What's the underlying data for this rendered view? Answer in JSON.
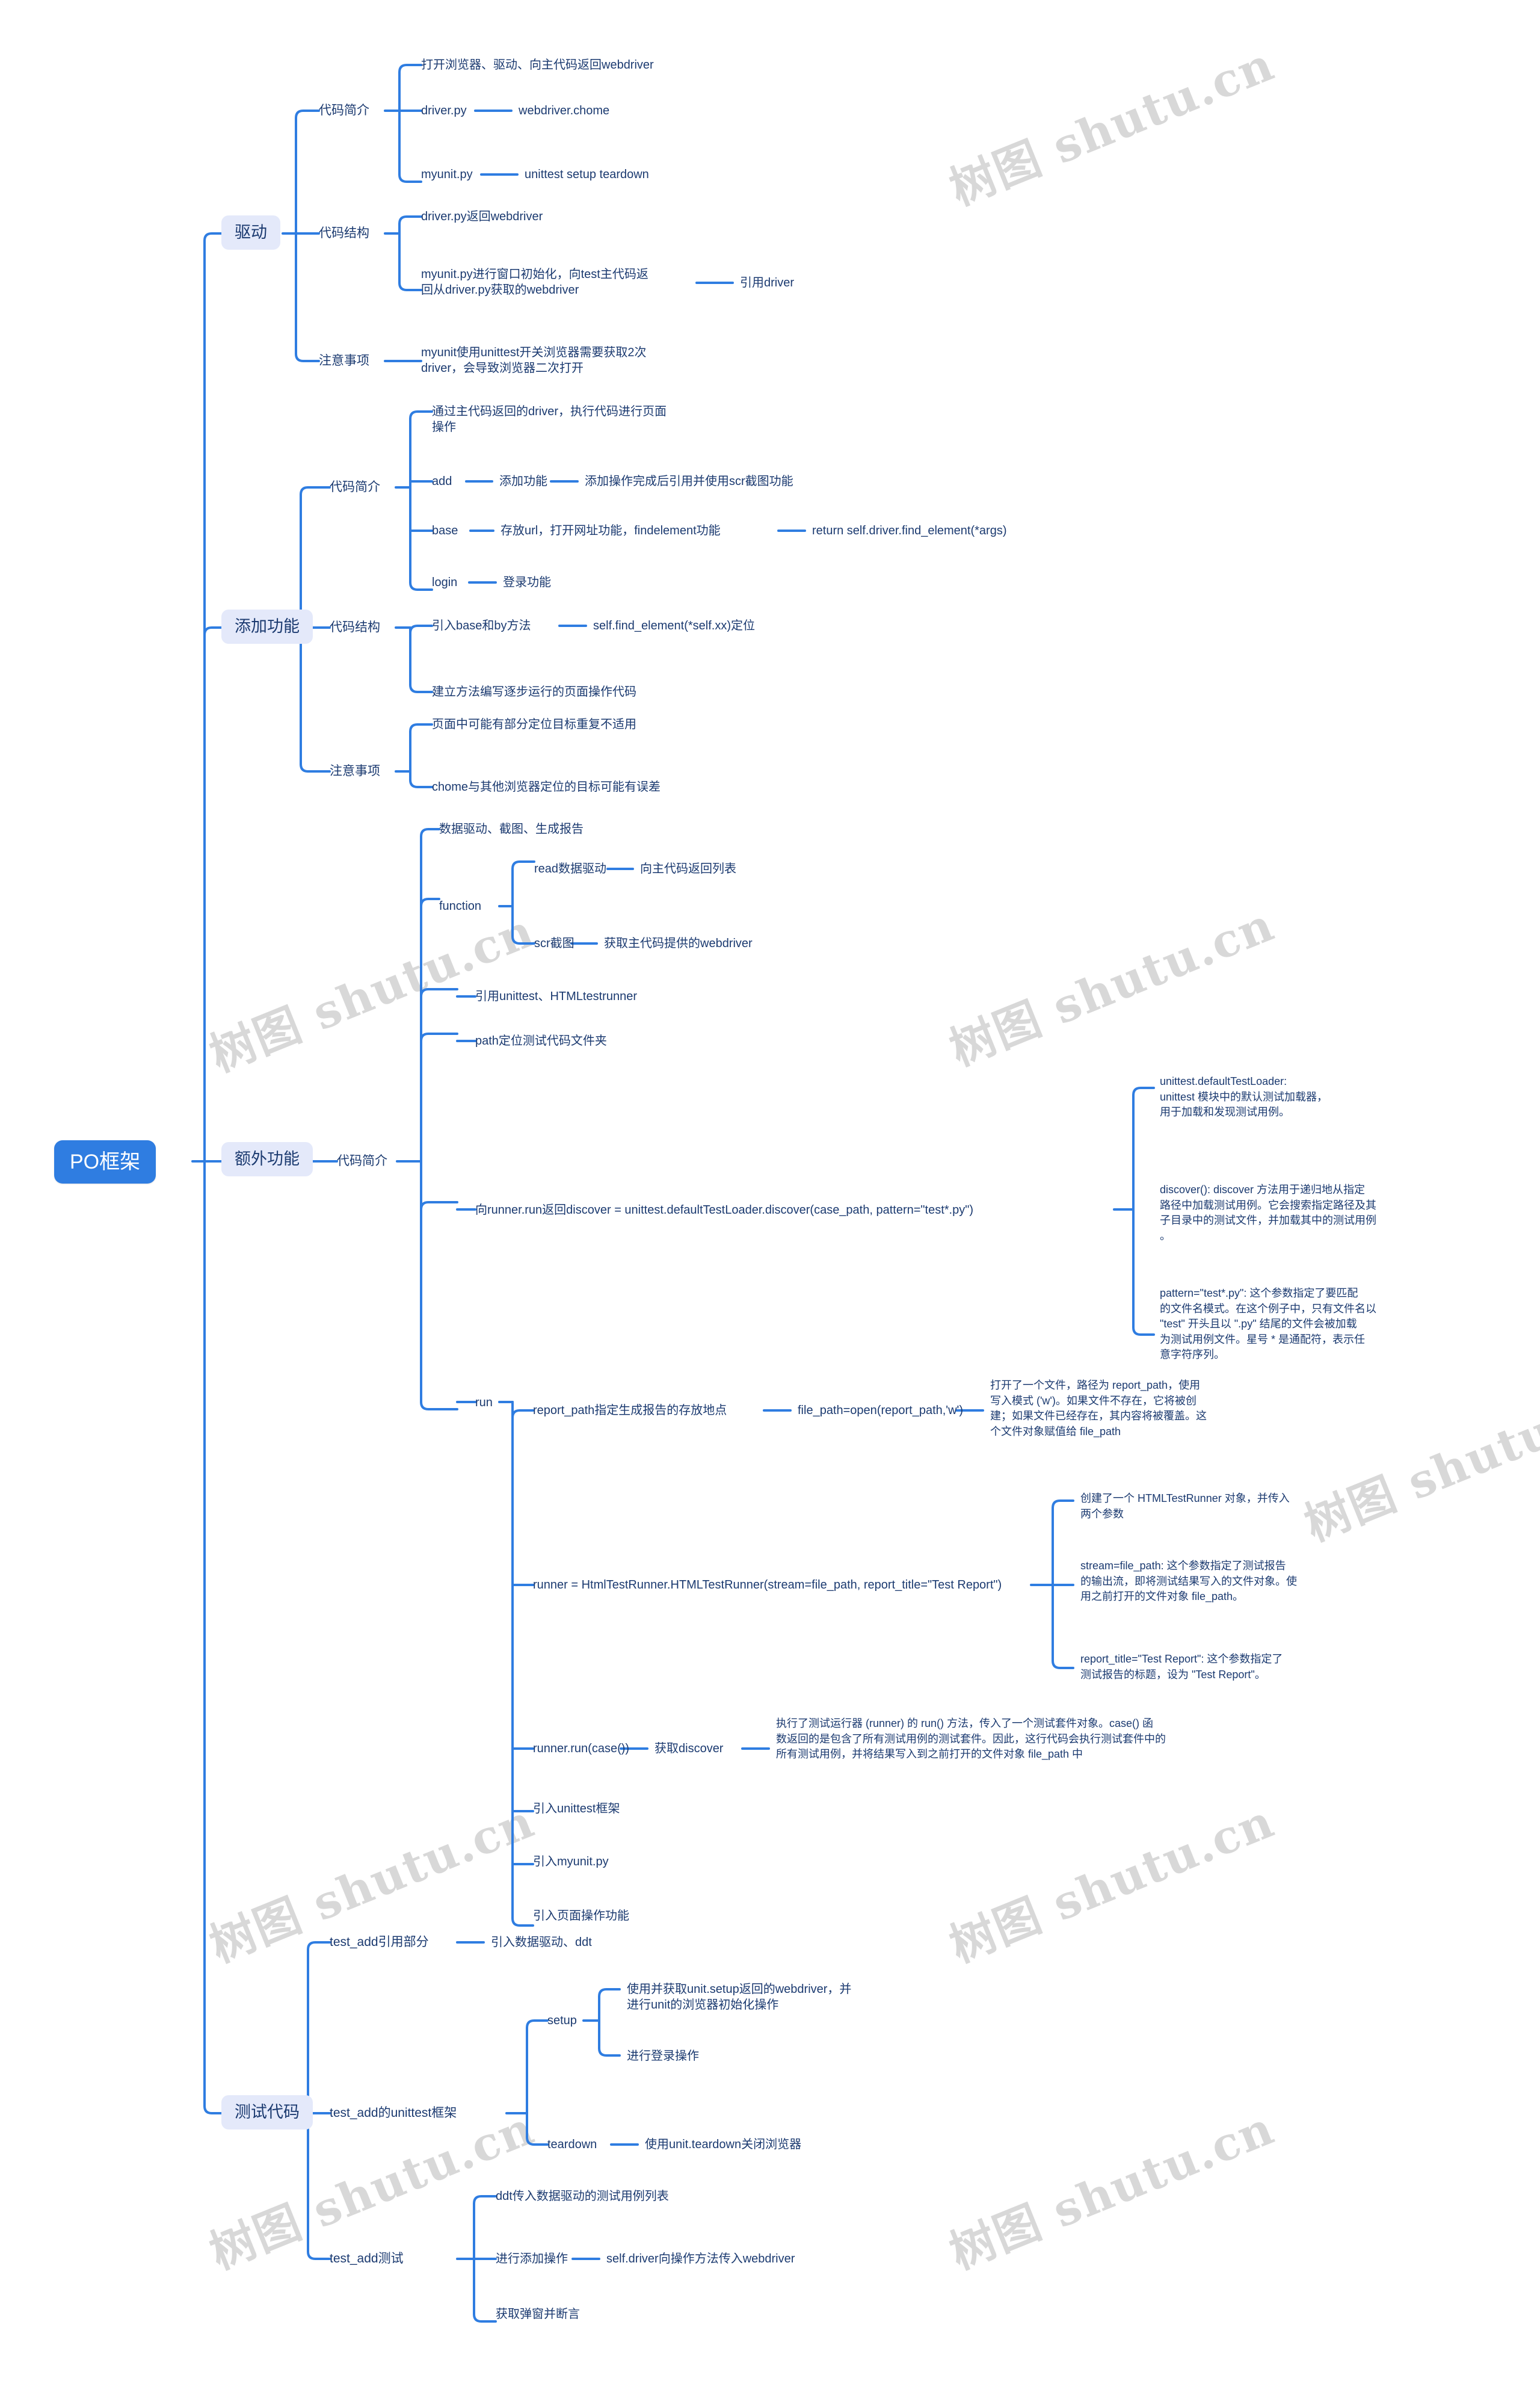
{
  "meta": {
    "watermark_text": "树图 shutu.cn",
    "accent_color": "#2f7de1",
    "root_bg": "#2f7de1",
    "branch_bg": "#e4e9fa",
    "text_color": "#1b3a70"
  },
  "root": {
    "label": "PO框架"
  },
  "branches": [
    {
      "label": "驱动",
      "groups": [
        {
          "label": "代码简介",
          "items": [
            {
              "label": "打开浏览器、驱动、向主代码返回webdriver",
              "children": []
            },
            {
              "label": "driver.py",
              "children": [
                {
                  "label": "webdriver.chome"
                }
              ]
            },
            {
              "label": "myunit.py",
              "children": [
                {
                  "label": "unittest  setup teardown"
                }
              ]
            }
          ]
        },
        {
          "label": "代码结构",
          "items": [
            {
              "label": "driver.py返回webdriver",
              "children": []
            },
            {
              "label": "myunit.py进行窗口初始化，向test主代码返\n回从driver.py获取的webdriver",
              "children": [
                {
                  "label": "引用driver"
                }
              ]
            }
          ]
        },
        {
          "label": "注意事项",
          "items": [
            {
              "label": "myunit使用unittest开关浏览器需要获取2次\ndriver，会导致浏览器二次打开",
              "children": []
            }
          ]
        }
      ]
    },
    {
      "label": "添加功能",
      "groups": [
        {
          "label": "代码简介",
          "items": [
            {
              "label": "通过主代码返回的driver，执行代码进行页面\n操作",
              "children": []
            },
            {
              "label": "add",
              "children": [
                {
                  "label": "添加功能"
                },
                {
                  "label": "添加操作完成后引用并使用scr截图功能"
                }
              ]
            },
            {
              "label": "base",
              "children": [
                {
                  "label": "存放url，打开网址功能，findelement功能"
                },
                {
                  "label": "return self.driver.find_element(*args)"
                }
              ]
            },
            {
              "label": "login",
              "children": [
                {
                  "label": "登录功能"
                }
              ]
            }
          ]
        },
        {
          "label": "代码结构",
          "items": [
            {
              "label": "引入base和by方法",
              "children": [
                {
                  "label": "self.find_element(*self.xx)定位"
                }
              ]
            },
            {
              "label": "建立方法编写逐步运行的页面操作代码",
              "children": []
            }
          ]
        },
        {
          "label": "注意事项",
          "items": [
            {
              "label": "页面中可能有部分定位目标重复不适用",
              "children": []
            },
            {
              "label": "chome与其他浏览器定位的目标可能有误差",
              "children": []
            }
          ]
        }
      ]
    },
    {
      "label": "额外功能",
      "groups": [
        {
          "label": "代码简介",
          "items": [
            {
              "label": "数据驱动、截图、生成报告",
              "children": []
            },
            {
              "label": "function",
              "children": [
                {
                  "label": "read数据驱动",
                  "grand": [
                    {
                      "label": "向主代码返回列表"
                    }
                  ]
                },
                {
                  "label": "scr截图",
                  "grand": [
                    {
                      "label": "获取主代码提供的webdriver"
                    }
                  ]
                }
              ]
            },
            {
              "label": "引用unittest、HTMLtestrunner",
              "children": []
            },
            {
              "label": "path定位测试代码文件夹",
              "children": []
            },
            {
              "label": "向runner.run返回discover = unittest.defaultTestLoader.discover(case_path, pattern=\"test*.py\")",
              "children": [
                {
                  "label": "unittest.defaultTestLoader:\nunittest 模块中的默认测试加载器，\n用于加载和发现测试用例。"
                },
                {
                  "label": "discover(): discover 方法用于递归地从指定\n路径中加载测试用例。它会搜索指定路径及其\n子目录中的测试文件，并加载其中的测试用例\n。"
                },
                {
                  "label": "pattern=\"test*.py\": 这个参数指定了要匹配\n的文件名模式。在这个例子中，只有文件名以\n \"test\" 开头且以 \".py\" 结尾的文件会被加载\n为测试用例文件。星号 * 是通配符，表示任\n意字符序列。"
                }
              ]
            },
            {
              "label": "run",
              "children": [
                {
                  "label": "report_path指定生成报告的存放地点",
                  "grand": [
                    {
                      "label": "file_path=open(report_path,'w')",
                      "great": [
                        {
                          "label": "打开了一个文件，路径为 report_path，使用\n写入模式 ('w')。如果文件不存在，它将被创\n建；如果文件已经存在，其内容将被覆盖。这\n个文件对象赋值给 file_path"
                        }
                      ]
                    }
                  ]
                },
                {
                  "label": "runner = HtmlTestRunner.HTMLTestRunner(stream=file_path, report_title=\"Test Report\")",
                  "grand": [
                    {
                      "label": "创建了一个 HTMLTestRunner 对象，并传入\n两个参数"
                    },
                    {
                      "label": "stream=file_path: 这个参数指定了测试报告\n的输出流，即将测试结果写入的文件对象。使\n用之前打开的文件对象 file_path。"
                    },
                    {
                      "label": "report_title=\"Test Report\": 这个参数指定了\n测试报告的标题，设为 \"Test Report\"。"
                    }
                  ]
                },
                {
                  "label": "runner.run(case())",
                  "grand": [
                    {
                      "label": "获取discover",
                      "great": [
                        {
                          "label": "执行了测试运行器 (runner) 的 run() 方法，传入了一个测试套件对象。case() 函\n数返回的是包含了所有测试用例的测试套件。因此，这行代码会执行测试套件中的\n所有测试用例，并将结果写入到之前打开的文件对象 file_path 中"
                        }
                      ]
                    }
                  ]
                },
                {
                  "label": "引入unittest框架",
                  "grand": []
                },
                {
                  "label": "引入myunit.py",
                  "grand": []
                },
                {
                  "label": "引入页面操作功能",
                  "grand": []
                }
              ]
            }
          ]
        }
      ]
    },
    {
      "label": "测试代码",
      "groups": [
        {
          "label": "test_add引用部分",
          "items": [
            {
              "label": "引入数据驱动、ddt",
              "children": []
            }
          ]
        },
        {
          "label": "test_add的unittest框架",
          "items": [
            {
              "label": "setup",
              "children": [
                {
                  "label": "使用并获取unit.setup返回的webdriver，并\n进行unit的浏览器初始化操作"
                },
                {
                  "label": "进行登录操作"
                }
              ]
            },
            {
              "label": "teardown",
              "children": [
                {
                  "label": "使用unit.teardown关闭浏览器"
                }
              ]
            }
          ]
        },
        {
          "label": "test_add测试",
          "items": [
            {
              "label": "ddt传入数据驱动的测试用例列表",
              "children": []
            },
            {
              "label": "进行添加操作",
              "children": [
                {
                  "label": "self.driver向操作方法传入webdriver"
                }
              ]
            },
            {
              "label": "获取弹窗并断言",
              "children": []
            }
          ]
        }
      ]
    }
  ],
  "nodes": {
    "root": "PO框架",
    "b1": "驱动",
    "b1g1": "代码简介",
    "b1g2": "代码结构",
    "b1g3": "注意事项",
    "b1g1i1": "打开浏览器、驱动、向主代码返回webdriver",
    "b1g1i2": "driver.py",
    "b1g1i2c1": "webdriver.chome",
    "b1g1i3": "myunit.py",
    "b1g1i3c1": "unittest  setup teardown",
    "b1g2i1": "driver.py返回webdriver",
    "b1g2i2": "myunit.py进行窗口初始化，向test主代码返\n回从driver.py获取的webdriver",
    "b1g2i2c1": "引用driver",
    "b1g3i1": "myunit使用unittest开关浏览器需要获取2次\ndriver，会导致浏览器二次打开",
    "b2": "添加功能",
    "b2g1": "代码简介",
    "b2g2": "代码结构",
    "b2g3": "注意事项",
    "b2g1i1": "通过主代码返回的driver，执行代码进行页面\n操作",
    "b2g1i2": "add",
    "b2g1i2c1": "添加功能",
    "b2g1i2c2": "添加操作完成后引用并使用scr截图功能",
    "b2g1i3": "base",
    "b2g1i3c1": "存放url，打开网址功能，findelement功能",
    "b2g1i3c2": "return self.driver.find_element(*args)",
    "b2g1i4": "login",
    "b2g1i4c1": "登录功能",
    "b2g2i1": "引入base和by方法",
    "b2g2i1c1": "self.find_element(*self.xx)定位",
    "b2g2i2": "建立方法编写逐步运行的页面操作代码",
    "b2g3i1": "页面中可能有部分定位目标重复不适用",
    "b2g3i2": "chome与其他浏览器定位的目标可能有误差",
    "b3": "额外功能",
    "b3g1": "代码简介",
    "b3i1": "数据驱动、截图、生成报告",
    "b3i2": "function",
    "b3i2c1": "read数据驱动",
    "b3i2c1g1": "向主代码返回列表",
    "b3i2c2": "scr截图",
    "b3i2c2g1": "获取主代码提供的webdriver",
    "b3i3": "引用unittest、HTMLtestrunner",
    "b3i4": "path定位测试代码文件夹",
    "b3i5": "向runner.run返回discover = unittest.defaultTestLoader.discover(case_path, pattern=\"test*.py\")",
    "b3i5c1": "unittest.defaultTestLoader:\nunittest 模块中的默认测试加载器，\n用于加载和发现测试用例。",
    "b3i5c2": "discover(): discover 方法用于递归地从指定\n路径中加载测试用例。它会搜索指定路径及其\n子目录中的测试文件，并加载其中的测试用例\n。",
    "b3i5c3": "pattern=\"test*.py\": 这个参数指定了要匹配\n的文件名模式。在这个例子中，只有文件名以\n \"test\" 开头且以 \".py\" 结尾的文件会被加载\n为测试用例文件。星号 * 是通配符，表示任\n意字符序列。",
    "b3i6": "run",
    "b3i6c1": "report_path指定生成报告的存放地点",
    "b3i6c1g1": "file_path=open(report_path,'w')",
    "b3i6c1g1x1": "打开了一个文件，路径为 report_path，使用\n写入模式 ('w')。如果文件不存在，它将被创\n建；如果文件已经存在，其内容将被覆盖。这\n个文件对象赋值给 file_path",
    "b3i6c2": "runner = HtmlTestRunner.HTMLTestRunner(stream=file_path, report_title=\"Test Report\")",
    "b3i6c2g1": "创建了一个 HTMLTestRunner 对象，并传入\n两个参数",
    "b3i6c2g2": "stream=file_path: 这个参数指定了测试报告\n的输出流，即将测试结果写入的文件对象。使\n用之前打开的文件对象 file_path。",
    "b3i6c2g3": "report_title=\"Test Report\": 这个参数指定了\n测试报告的标题，设为 \"Test Report\"。",
    "b3i6c3": "runner.run(case())",
    "b3i6c3g1": "获取discover",
    "b3i6c3g1x1": "执行了测试运行器 (runner) 的 run() 方法，传入了一个测试套件对象。case() 函\n数返回的是包含了所有测试用例的测试套件。因此，这行代码会执行测试套件中的\n所有测试用例，并将结果写入到之前打开的文件对象 file_path 中",
    "b3i6c4": "引入unittest框架",
    "b3i6c5": "引入myunit.py",
    "b3i6c6": "引入页面操作功能",
    "b4": "测试代码",
    "b4g1": "test_add引用部分",
    "b4g1c1": "引入数据驱动、ddt",
    "b4g2": "test_add的unittest框架",
    "b4g2i1": "setup",
    "b4g2i1c1": "使用并获取unit.setup返回的webdriver，并\n进行unit的浏览器初始化操作",
    "b4g2i1c2": "进行登录操作",
    "b4g2i2": "teardown",
    "b4g2i2c1": "使用unit.teardown关闭浏览器",
    "b4g3": "test_add测试",
    "b4g3i1": "ddt传入数据驱动的测试用例列表",
    "b4g3i2": "进行添加操作",
    "b4g3i2c1": "self.driver向操作方法传入webdriver",
    "b4g3i3": "获取弹窗并断言"
  }
}
